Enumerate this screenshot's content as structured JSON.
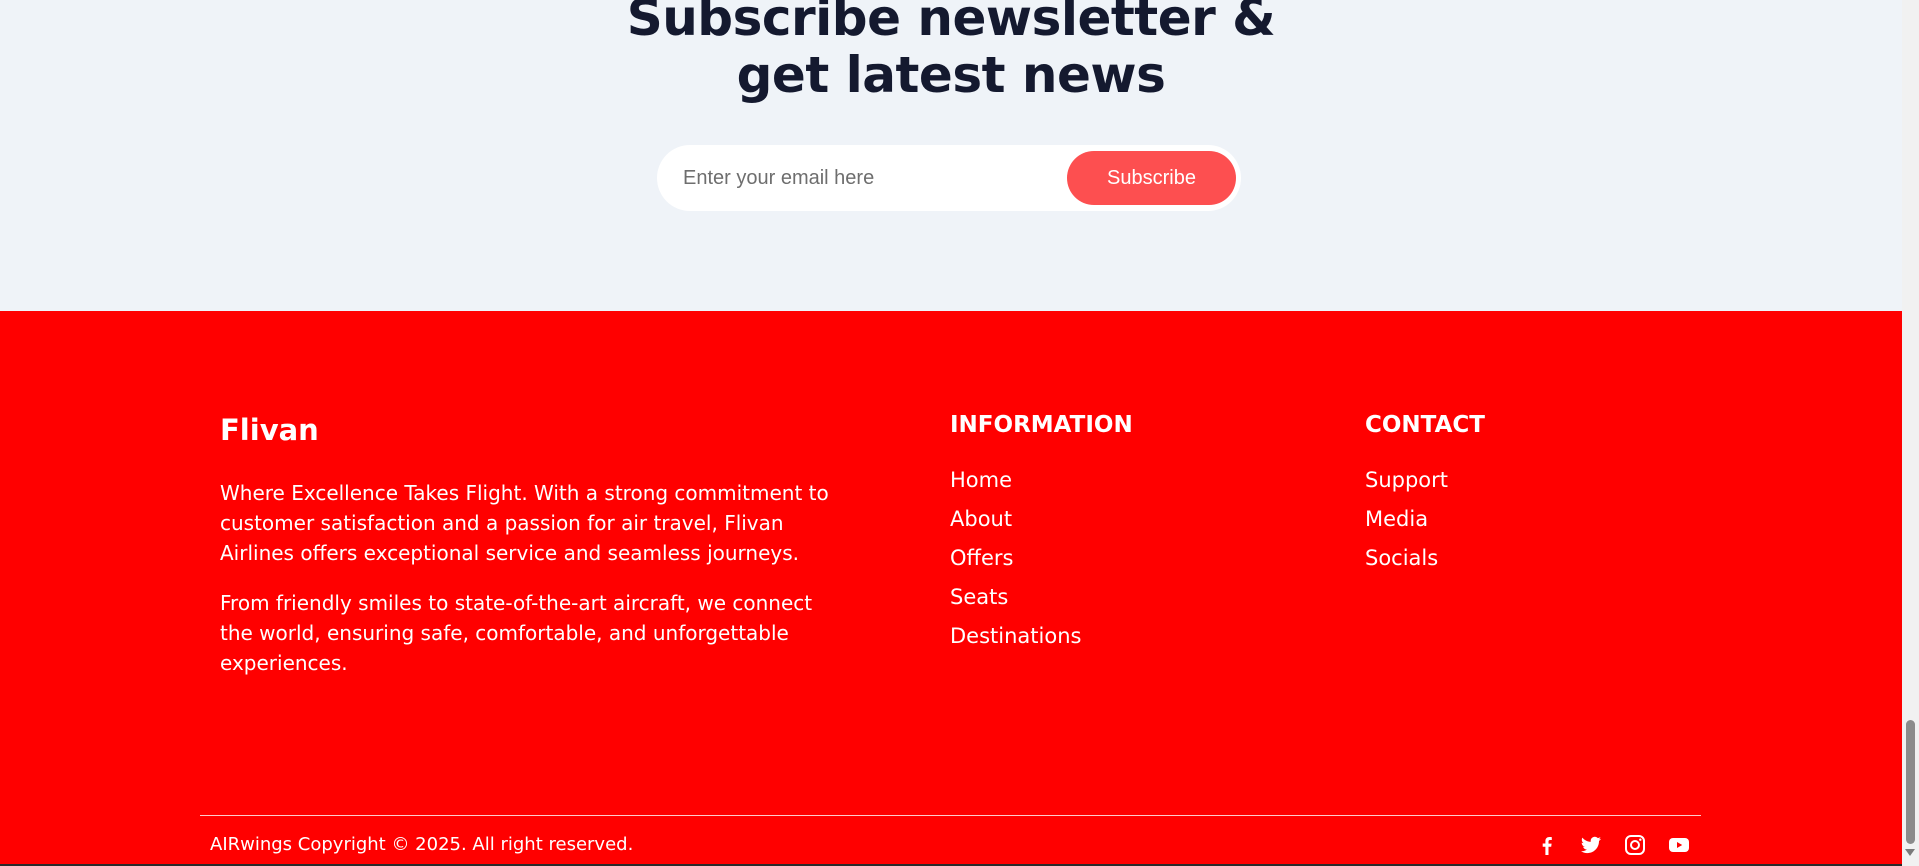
{
  "newsletter": {
    "title_line1": "Subscribe newsletter &",
    "title_line2": "get latest news",
    "email_placeholder": "Enter your email here",
    "subscribe_label": "Subscribe"
  },
  "footer": {
    "brand": "Flivan",
    "about_p1": "Where Excellence Takes Flight. With a strong commitment to customer satisfaction and a passion for air travel, Flivan Airlines offers exceptional service and seamless journeys.",
    "about_p2": "From friendly smiles to state-of-the-art aircraft, we connect the world, ensuring safe, comfortable, and unforgettable experiences.",
    "information": {
      "title": "INFORMATION",
      "links": [
        "Home",
        "About",
        "Offers",
        "Seats",
        "Destinations"
      ]
    },
    "contact": {
      "title": "CONTACT",
      "links": [
        "Support",
        "Media",
        "Socials"
      ]
    },
    "copyright": "AIRwings Copyright © 2025. All right reserved.",
    "socials": [
      "facebook-icon",
      "twitter-icon",
      "instagram-icon",
      "youtube-icon"
    ]
  },
  "colors": {
    "footer_bg": "#ff0000",
    "subscribe_button": "#fd4f50",
    "newsletter_bg": "#eff3f8",
    "title_text": "#14192f"
  }
}
